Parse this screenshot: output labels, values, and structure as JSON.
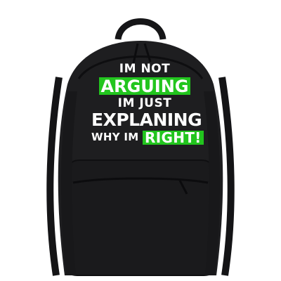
{
  "design": {
    "line1": "IM NOT",
    "line2": "ARGUING",
    "line3": "IM JUST",
    "line4": "EXPLANING",
    "line5_prefix": "WHY IM",
    "line5_highlight": "RIGHT!"
  },
  "colors": {
    "background": "#ffffff",
    "bag_body": "#1e1e20",
    "bag_shadow": "#111113",
    "print_text": "#ffffff",
    "print_highlight": "#22c51e"
  }
}
